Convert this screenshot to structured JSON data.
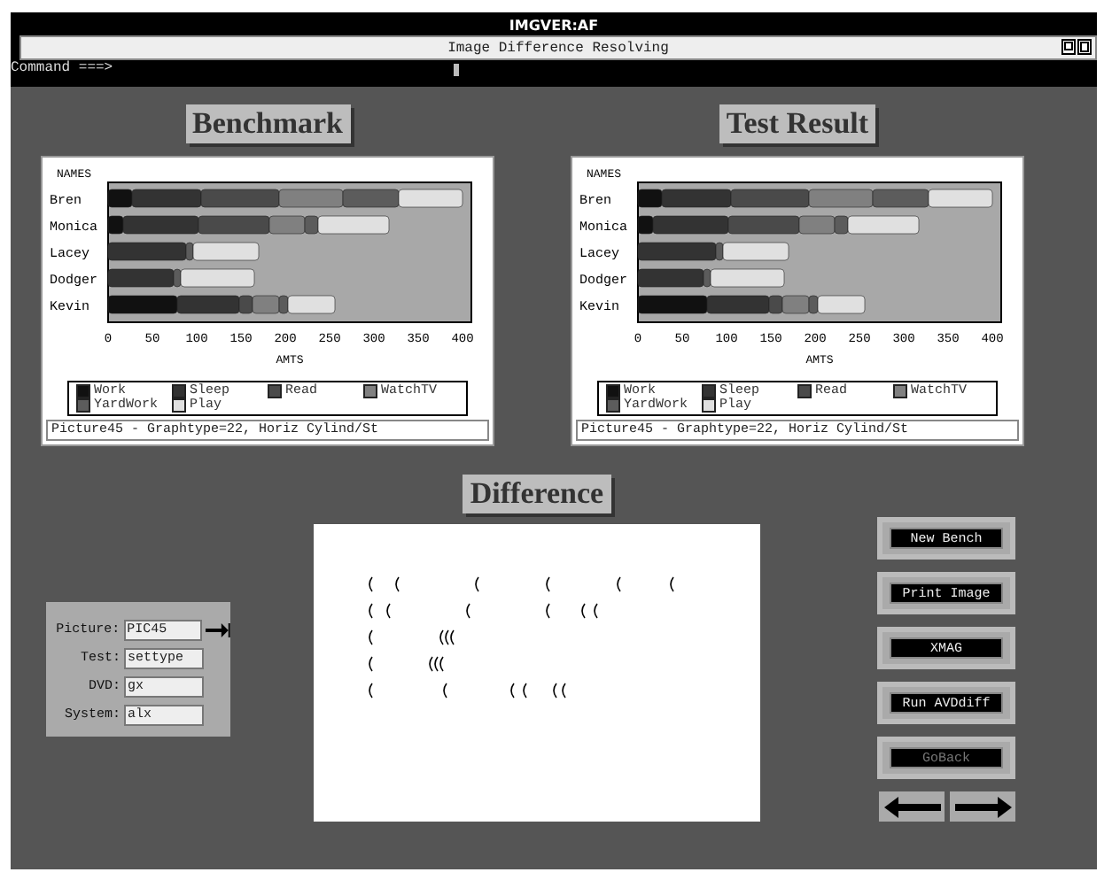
{
  "window": {
    "title": "IMGVER:AF"
  },
  "header": {
    "title": "Image Difference Resolving",
    "command_label": "Command ===>"
  },
  "charts": [
    {
      "heading": "Benchmark",
      "caption": "Picture45 - Graphtype=22, Horiz Cylind/St",
      "chart_data": {
        "type": "bar",
        "orientation": "horizontal",
        "stacked": true,
        "ylabel": "NAMES",
        "xlabel": "AMTS",
        "categories": [
          "Bren",
          "Monica",
          "Lacey",
          "Dodger",
          "Kevin"
        ],
        "xlim": [
          0,
          410
        ],
        "xticks": [
          0,
          50,
          100,
          150,
          200,
          250,
          300,
          350,
          400
        ],
        "series": [
          {
            "name": "Work",
            "color": "#111111",
            "values": [
              27,
              17,
              0,
              0,
              78
            ]
          },
          {
            "name": "Sleep",
            "color": "#333333",
            "values": [
              78,
              85,
              88,
              74,
              70
            ]
          },
          {
            "name": "Read",
            "color": "#4a4a4a",
            "values": [
              88,
              80,
              0,
              0,
              15
            ]
          },
          {
            "name": "WatchTV",
            "color": "#808080",
            "values": [
              72,
              40,
              0,
              0,
              30
            ]
          },
          {
            "name": "YardWork",
            "color": "#5c5c5c",
            "values": [
              63,
              15,
              8,
              8,
              10
            ]
          },
          {
            "name": "Play",
            "color": "#e0e0e0",
            "values": [
              72,
              80,
              74,
              83,
              53
            ]
          }
        ]
      }
    },
    {
      "heading": "Test Result",
      "caption": "Picture45 - Graphtype=22, Horiz Cylind/St",
      "chart_data": {
        "type": "bar",
        "orientation": "horizontal",
        "stacked": true,
        "ylabel": "NAMES",
        "xlabel": "AMTS",
        "categories": [
          "Bren",
          "Monica",
          "Lacey",
          "Dodger",
          "Kevin"
        ],
        "xlim": [
          0,
          410
        ],
        "xticks": [
          0,
          50,
          100,
          150,
          200,
          250,
          300,
          350,
          400
        ],
        "series": [
          {
            "name": "Work",
            "color": "#111111",
            "values": [
              27,
              17,
              0,
              0,
              78
            ]
          },
          {
            "name": "Sleep",
            "color": "#333333",
            "values": [
              78,
              85,
              88,
              74,
              70
            ]
          },
          {
            "name": "Read",
            "color": "#4a4a4a",
            "values": [
              88,
              80,
              0,
              0,
              15
            ]
          },
          {
            "name": "WatchTV",
            "color": "#808080",
            "values": [
              72,
              40,
              0,
              0,
              30
            ]
          },
          {
            "name": "YardWork",
            "color": "#5c5c5c",
            "values": [
              63,
              15,
              8,
              8,
              10
            ]
          },
          {
            "name": "Play",
            "color": "#e0e0e0",
            "values": [
              72,
              80,
              74,
              83,
              53
            ]
          }
        ]
      }
    }
  ],
  "difference": {
    "heading": "Difference"
  },
  "form": {
    "fields": [
      {
        "label": "Picture:",
        "value": "PIC45",
        "kind": "picker"
      },
      {
        "label": "Test:",
        "value": "settype",
        "kind": "text"
      },
      {
        "label": "DVD:",
        "value": "gx",
        "kind": "text"
      },
      {
        "label": "System:",
        "value": "alx",
        "kind": "text"
      }
    ]
  },
  "buttons": [
    {
      "label": "New Bench",
      "disabled": false
    },
    {
      "label": "Print Image",
      "disabled": false
    },
    {
      "label": "XMAG",
      "disabled": false
    },
    {
      "label": "Run AVDdiff",
      "disabled": false
    },
    {
      "label": "GoBack",
      "disabled": true
    }
  ]
}
